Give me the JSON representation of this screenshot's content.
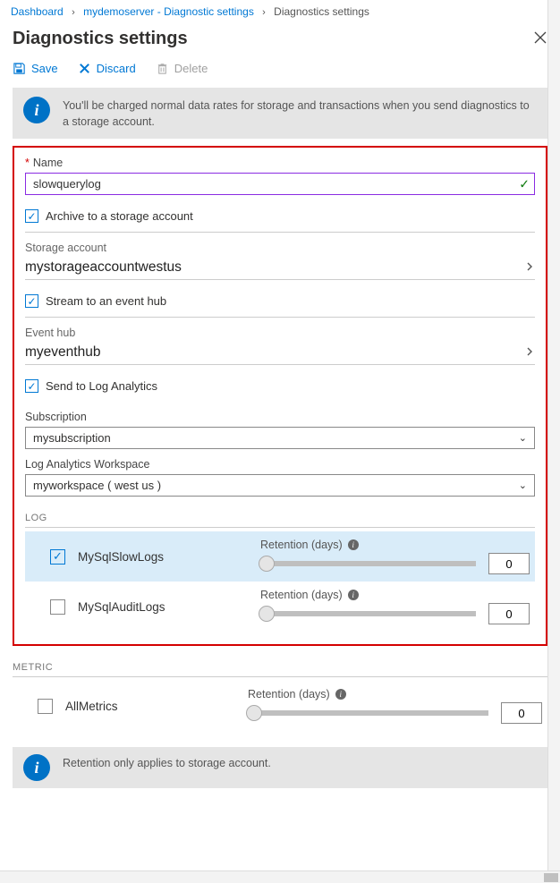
{
  "breadcrumb": {
    "root": "Dashboard",
    "parent": "mydemoserver - Diagnostic settings",
    "current": "Diagnostics settings"
  },
  "page_title": "Diagnostics settings",
  "toolbar": {
    "save": "Save",
    "discard": "Discard",
    "delete": "Delete"
  },
  "banner1": "You'll be charged normal data rates for storage and transactions when you send diagnostics to a storage account.",
  "banner2": "Retention only applies to storage account.",
  "name": {
    "label": "Name",
    "value": "slowquerylog"
  },
  "archive": {
    "chk_label": "Archive to a storage account",
    "checked": true,
    "field_label": "Storage account",
    "field_value": "mystorageaccountwestus"
  },
  "eventhub": {
    "chk_label": "Stream to an event hub",
    "checked": true,
    "field_label": "Event hub",
    "field_value": "myeventhub"
  },
  "log_analytics": {
    "chk_label": "Send to Log Analytics",
    "checked": true,
    "subscription_label": "Subscription",
    "subscription_value": "mysubscription",
    "workspace_label": "Log Analytics Workspace",
    "workspace_value": "myworkspace ( west us )"
  },
  "log_header": "LOG",
  "metric_header": "METRIC",
  "retention_label": "Retention (days)",
  "log_items": [
    {
      "name": "MySqlSlowLogs",
      "checked": true,
      "retention": "0"
    },
    {
      "name": "MySqlAuditLogs",
      "checked": false,
      "retention": "0"
    }
  ],
  "metric_items": [
    {
      "name": "AllMetrics",
      "checked": false,
      "retention": "0"
    }
  ]
}
